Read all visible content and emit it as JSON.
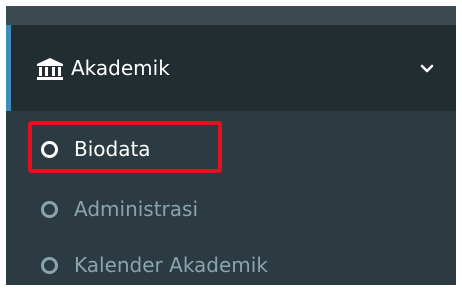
{
  "menu": {
    "section": {
      "label": "Akademik",
      "icon": "bank-icon",
      "expand_icon": "chevron-down-icon"
    },
    "items": [
      {
        "label": "Biodata",
        "icon": "circle-icon",
        "active": true
      },
      {
        "label": "Administrasi",
        "icon": "circle-icon",
        "active": false
      },
      {
        "label": "Kalender Akademik",
        "icon": "circle-icon",
        "active": false
      }
    ]
  },
  "colors": {
    "sidebar_bg": "#222d32",
    "submenu_bg": "#2c3b41",
    "accent": "#3c8dbc",
    "highlight": "#e3101e",
    "muted_text": "#8aa4af"
  }
}
